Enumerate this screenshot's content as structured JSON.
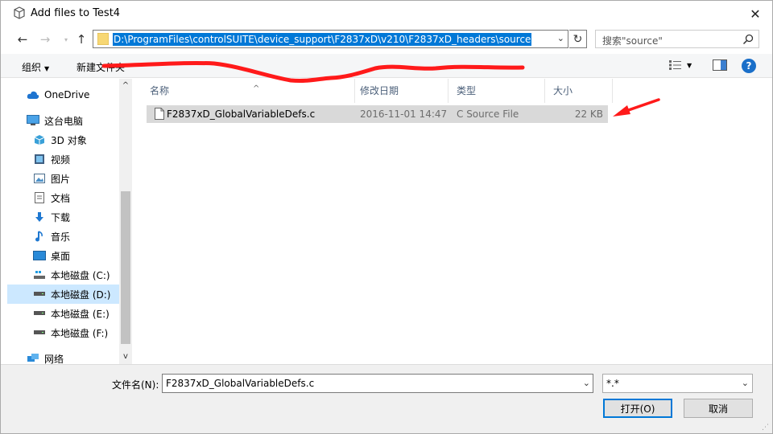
{
  "window": {
    "title": "Add files to Test4",
    "close_glyph": "✕"
  },
  "nav": {
    "back_glyph": "←",
    "forward_glyph": "→",
    "recent_glyph": "▾",
    "up_glyph": "↑"
  },
  "address": {
    "path": "D:\\ProgramFiles\\controlSUITE\\device_support\\F2837xD\\v210\\F2837xD_headers\\source",
    "dropdown_glyph": "⌄",
    "refresh_glyph": "↻"
  },
  "search": {
    "placeholder": "搜索\"source\""
  },
  "toolbar": {
    "organize_label": "组织",
    "organize_caret": "▼",
    "newfolder_label": "新建文件夹",
    "view_caret": "▼",
    "help_label": "?"
  },
  "sidebar": {
    "items": [
      {
        "label": "OneDrive",
        "icon": "cloud-icon"
      },
      {
        "label": "这台电脑",
        "icon": "computer-icon"
      },
      {
        "label": "3D 对象",
        "icon": "cube-icon"
      },
      {
        "label": "视频",
        "icon": "video-icon"
      },
      {
        "label": "图片",
        "icon": "picture-icon"
      },
      {
        "label": "文档",
        "icon": "document-icon"
      },
      {
        "label": "下载",
        "icon": "download-icon"
      },
      {
        "label": "音乐",
        "icon": "music-icon"
      },
      {
        "label": "桌面",
        "icon": "desktop-icon"
      },
      {
        "label": "本地磁盘 (C:)",
        "icon": "drive-windows-icon"
      },
      {
        "label": "本地磁盘 (D:)",
        "icon": "drive-icon",
        "selected": true
      },
      {
        "label": "本地磁盘 (E:)",
        "icon": "drive-icon"
      },
      {
        "label": "本地磁盘 (F:)",
        "icon": "drive-icon"
      },
      {
        "label": "网络",
        "icon": "network-icon"
      }
    ],
    "scroll_up_glyph": "^",
    "scroll_down_glyph": "v"
  },
  "filelist": {
    "columns": [
      "名称",
      "修改日期",
      "类型",
      "大小"
    ],
    "sort_glyph": "^",
    "rows": [
      {
        "name": "F2837xD_GlobalVariableDefs.c",
        "modified": "2016-11-01 14:47",
        "type": "C Source File",
        "size": "22 KB"
      }
    ]
  },
  "bottom": {
    "filename_label": "文件名(N):",
    "filename_value": "F2837xD_GlobalVariableDefs.c",
    "filter_value": "*.*",
    "dropdown_glyph": "⌄",
    "open_label": "打开(O)",
    "cancel_label": "取消"
  },
  "colors": {
    "accent": "#0078d7",
    "selection": "#cce8ff",
    "annotation": "#ff1a1a"
  }
}
